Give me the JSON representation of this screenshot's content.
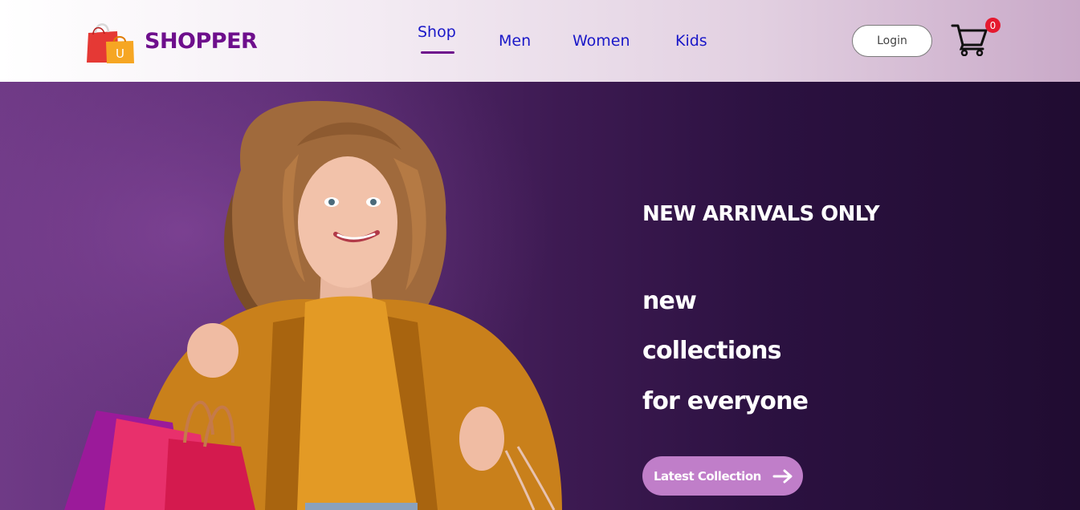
{
  "brand": {
    "name": "SHOPPER",
    "logo_icon": "shopping-bags-logo",
    "logo_letter": "U",
    "colors": {
      "primary": "#6e0f8c"
    }
  },
  "nav": {
    "items": [
      {
        "label": "Shop",
        "active": true
      },
      {
        "label": "Men",
        "active": false
      },
      {
        "label": "Women",
        "active": false
      },
      {
        "label": "Kids",
        "active": false
      }
    ],
    "link_color": "#1a18c8"
  },
  "header": {
    "login_label": "Login",
    "cart_icon": "cart-icon",
    "cart_count": "0",
    "cart_badge_color": "#e5192f"
  },
  "hero": {
    "tagline": "NEW ARRIVALS ONLY",
    "headline_lines": [
      "new",
      "collections",
      "for everyone"
    ],
    "cta_label": "Latest Collection",
    "cta_icon": "arrow-right-icon",
    "cta_color": "#c07ec9",
    "image_icon": "woman-with-shopping-bags-photo"
  }
}
